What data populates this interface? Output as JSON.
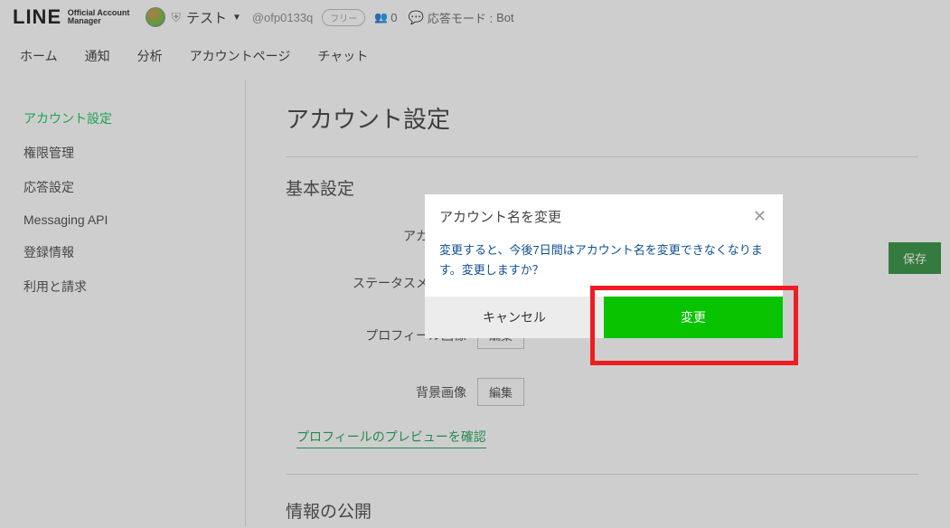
{
  "logo": {
    "main": "LINE",
    "sub1": "Official Account",
    "sub2": "Manager"
  },
  "header": {
    "account_name": "テスト",
    "account_id": "@ofp0133q",
    "plan_badge": "フリー",
    "friends_count": "0",
    "mode_prefix": "応答モード :",
    "mode_value": "Bot"
  },
  "nav": {
    "home": "ホーム",
    "notifications": "通知",
    "analytics": "分析",
    "account_page": "アカウントページ",
    "chat": "チャット"
  },
  "sidebar": {
    "account_settings": "アカウント設定",
    "permissions": "権限管理",
    "response_settings": "応答設定",
    "messaging_api": "Messaging API",
    "registration": "登録情報",
    "billing": "利用と請求"
  },
  "page": {
    "title": "アカウント設定",
    "basic_section": "基本設定",
    "account_name_label": "アカウント",
    "status_message_label": "ステータスメッセー",
    "profile_image_label": "プロフィール画像",
    "background_image_label": "背景画像",
    "edit_button": "編集",
    "save_button": "保存",
    "preview_link": "プロフィールのプレビューを確認",
    "info_section": "情報の公開"
  },
  "modal": {
    "title": "アカウント名を変更",
    "body": "変更すると、今後7日間はアカウント名を変更できなくなります。変更しますか？",
    "cancel": "キャンセル",
    "change": "変更"
  }
}
